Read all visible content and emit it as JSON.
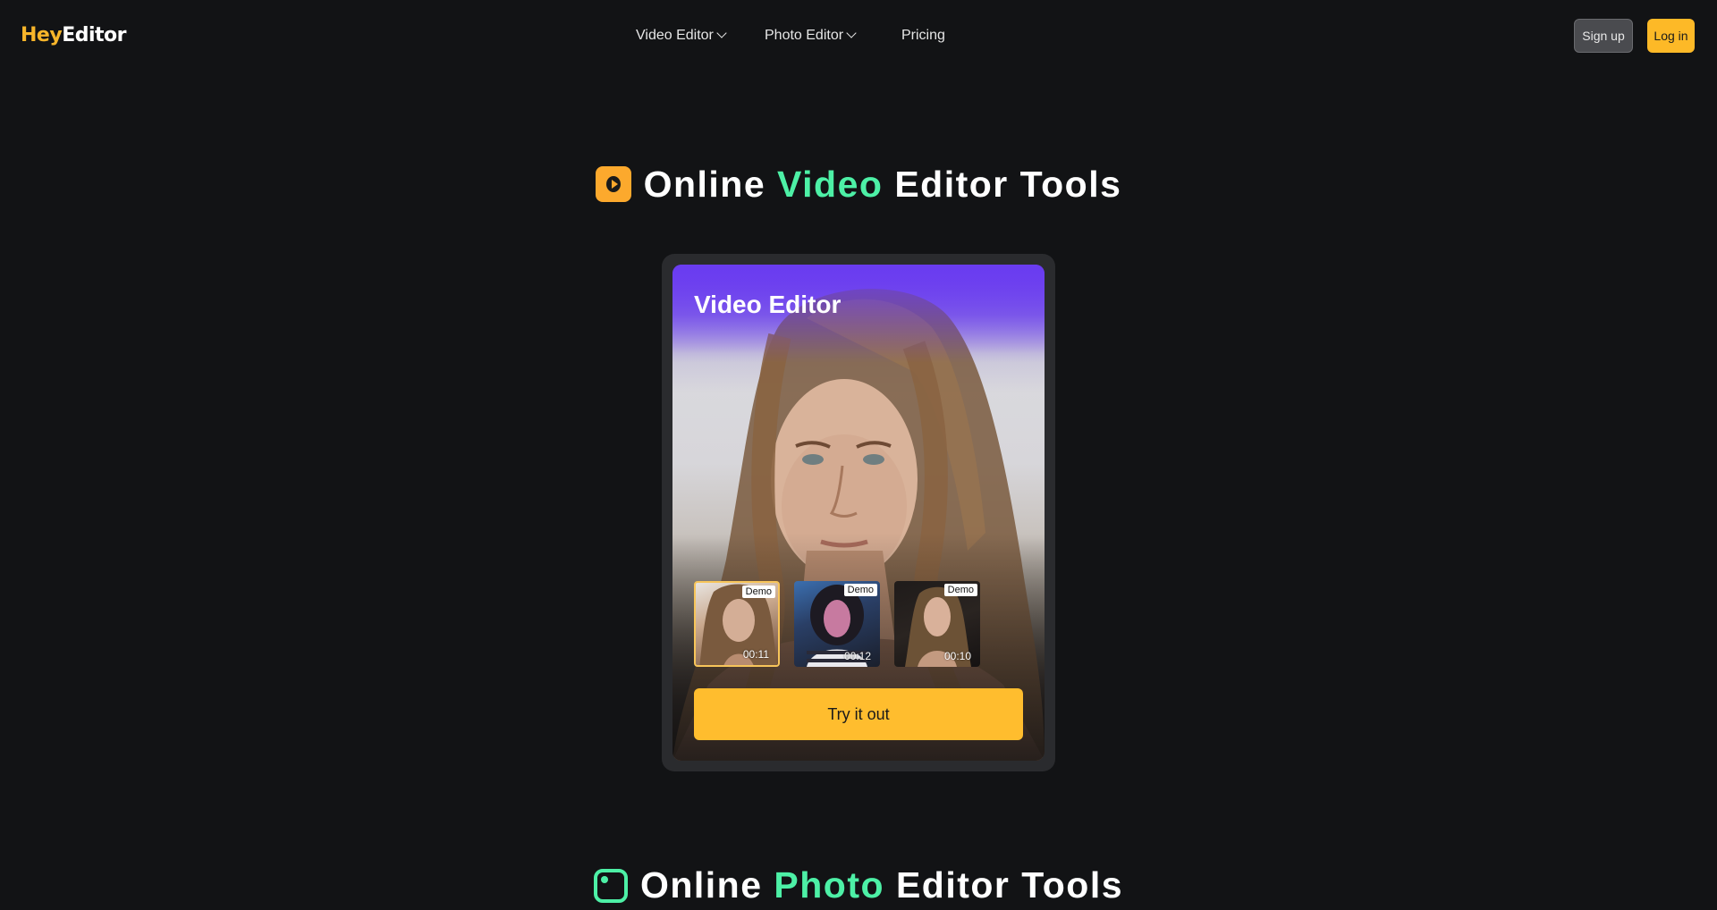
{
  "header": {
    "logo": {
      "part1": "Hey",
      "part2": "Editor"
    },
    "nav": [
      {
        "label": "Video Editor",
        "has_dropdown": true
      },
      {
        "label": "Photo Editor",
        "has_dropdown": true
      },
      {
        "label": "Pricing",
        "has_dropdown": false
      }
    ],
    "signup_label": "Sign up",
    "login_label": "Log in"
  },
  "video_section": {
    "title": {
      "pre": "Online ",
      "accent": "Video",
      "post": " Editor Tools"
    },
    "icon": "play-icon",
    "card": {
      "heading": "Video Editor",
      "thumbnails": [
        {
          "badge": "Demo",
          "duration": "00:11",
          "selected": true
        },
        {
          "badge": "Demo",
          "duration": "00:12",
          "selected": false
        },
        {
          "badge": "Demo",
          "duration": "00:10",
          "selected": false
        }
      ],
      "cta_label": "Try it out"
    }
  },
  "photo_section": {
    "title": {
      "pre": "Online ",
      "accent": "Photo",
      "post": " Editor Tools"
    },
    "icon": "image-icon"
  },
  "colors": {
    "background": "#121315",
    "brand_yellow": "#fdb927",
    "accent_green": "#4df0a6",
    "card_gradient_top": "#6b3cf0"
  }
}
